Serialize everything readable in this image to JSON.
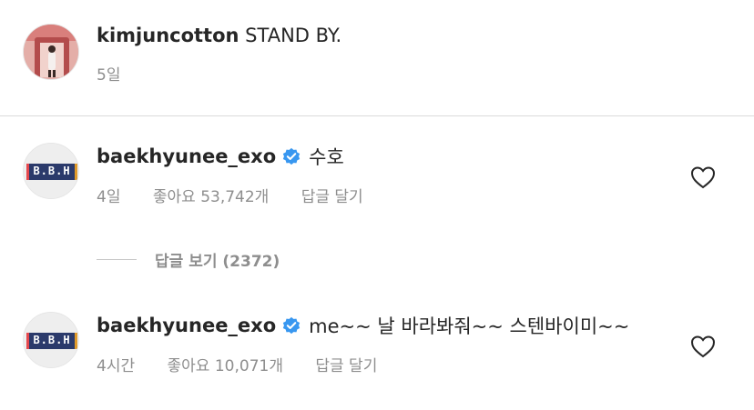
{
  "post": {
    "author": "kimjuncotton",
    "caption": "STAND BY.",
    "time": "5일"
  },
  "comments": [
    {
      "username": "baekhyunee_exo",
      "verified": true,
      "text": "수호",
      "time": "4일",
      "likes": "좋아요 53,742개",
      "reply_label": "답글 달기",
      "avatar_text": "B.B.H"
    },
    {
      "username": "baekhyunee_exo",
      "verified": true,
      "text": "me~~ 날 바라봐줘~~ 스텐바이미~~",
      "time": "4시간",
      "likes": "좋아요 10,071개",
      "reply_label": "답글 달기",
      "avatar_text": "B.B.H"
    }
  ],
  "view_replies": "답글 보기 (2372)",
  "icons": {
    "heart": "heart-outline-icon",
    "verified": "verified-badge-icon"
  },
  "colors": {
    "verified": "#3897f0",
    "secondary_text": "#8e8e8e",
    "divider": "#dbdbdb"
  }
}
